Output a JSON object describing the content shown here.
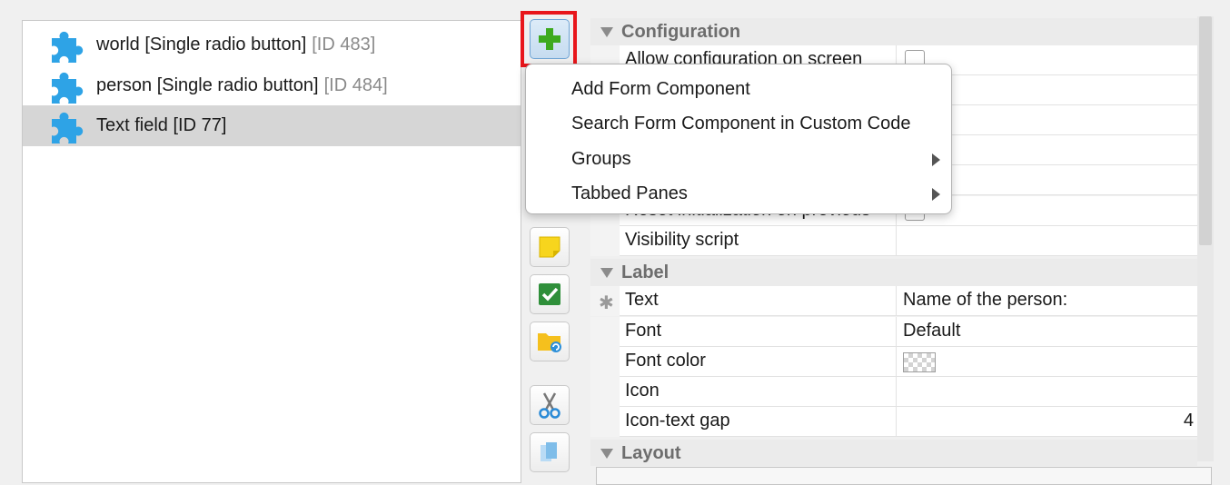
{
  "tree": {
    "items": [
      {
        "label": "world [Single radio button]",
        "id": "[ID 483]"
      },
      {
        "label": "person [Single radio button]",
        "id": "[ID 484]"
      },
      {
        "label": "Text field [ID 77]",
        "id": ""
      }
    ],
    "selected_index": 2
  },
  "toolbar": {
    "buttons": [
      {
        "icon": "add-plus-icon",
        "active": true
      },
      {
        "icon": "sticky-note-icon"
      },
      {
        "icon": "checkbox-icon"
      },
      {
        "icon": "folder-sync-icon"
      },
      {
        "icon": "scissors-icon"
      },
      {
        "icon": "copy-icon"
      }
    ]
  },
  "context_menu": {
    "items": [
      {
        "label": "Add Form Component",
        "submenu": false
      },
      {
        "label": "Search Form Component in Custom Code",
        "submenu": false
      },
      {
        "label": "Groups",
        "submenu": true
      },
      {
        "label": "Tabbed Panes",
        "submenu": true
      }
    ]
  },
  "properties": {
    "sections": {
      "configuration": "Configuration",
      "label": "Label",
      "layout": "Layout"
    },
    "rows": {
      "allow_config": "Allow configuration on screen",
      "reset_init": "Reset initialization on previous",
      "visibility": "Visibility script",
      "text": "Text",
      "text_value": "Name of the person:",
      "font": "Font",
      "font_value": "Default",
      "font_color": "Font color",
      "icon": "Icon",
      "icon_text_gap": "Icon-text gap",
      "icon_text_gap_value": "4"
    },
    "colors": {
      "selected_row": "#d6d6d6",
      "highlight": "#e8161b",
      "plus_green": "#3daa1e"
    }
  }
}
